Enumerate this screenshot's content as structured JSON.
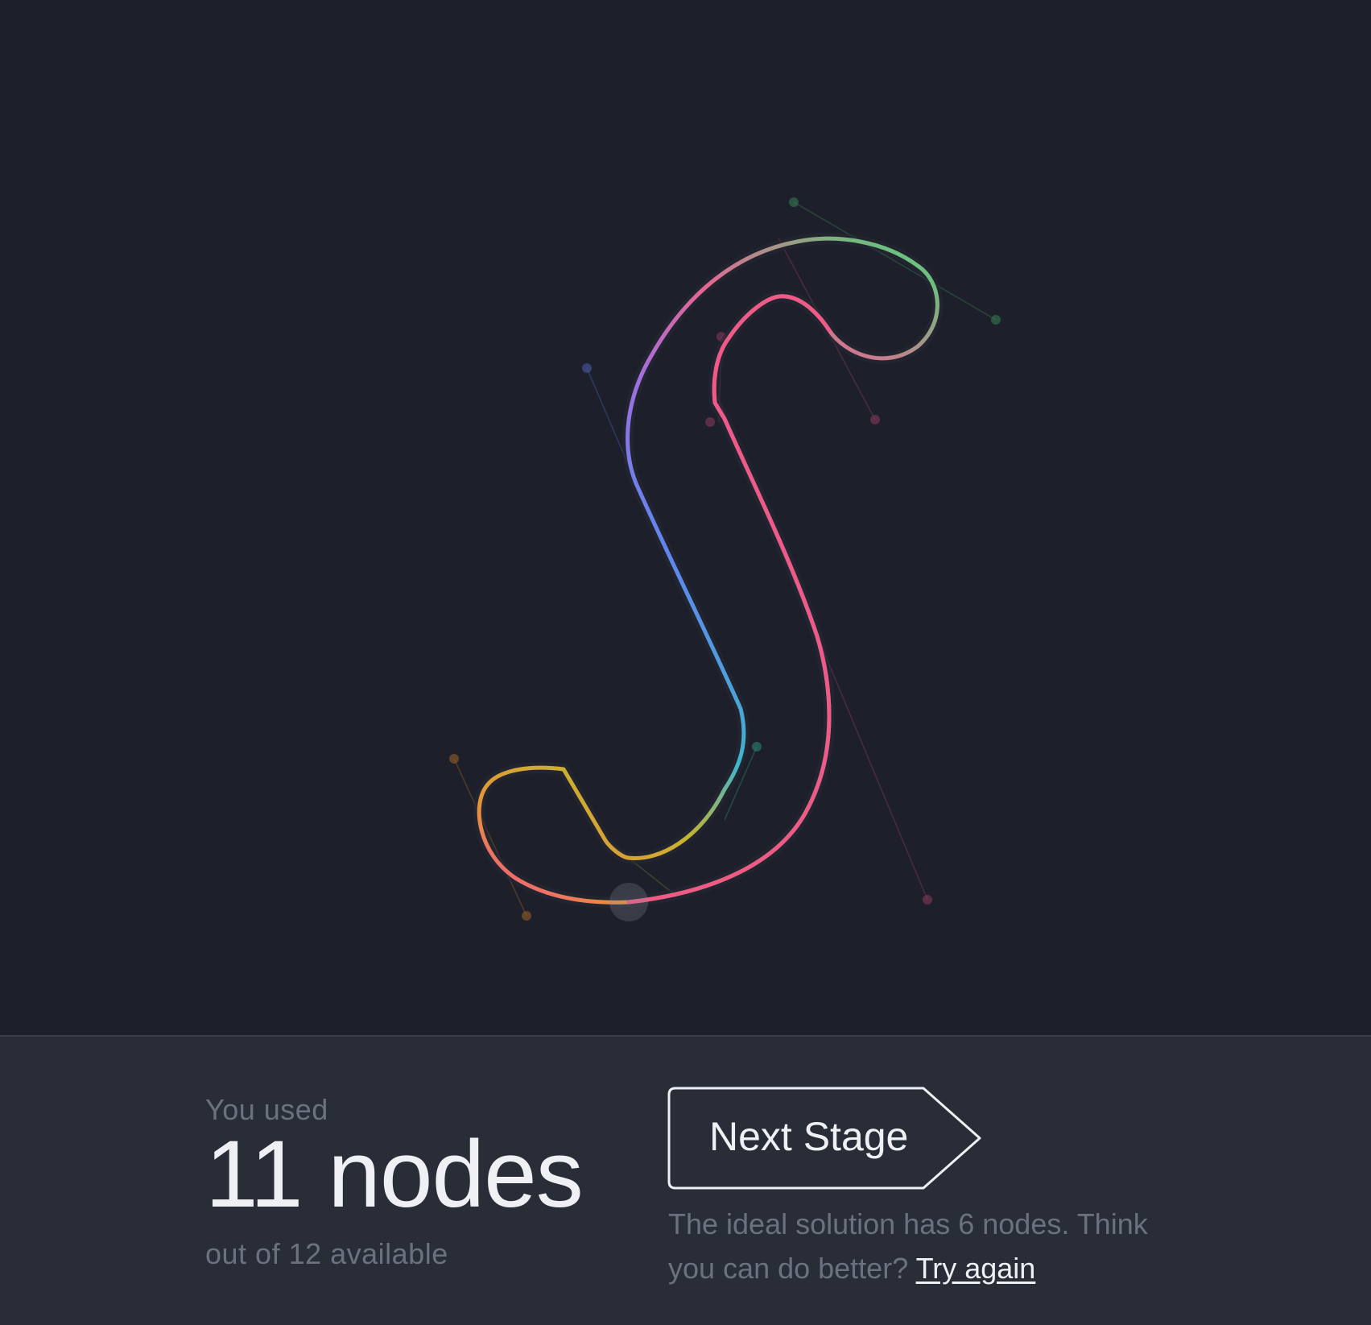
{
  "stage": {
    "glyph_letter": "S",
    "path_color": "#ef5a86",
    "gradient_stops": [
      "#6bc17f",
      "#e86592",
      "#a26ee0",
      "#5f86ef",
      "#3fb5cc",
      "#c6b42d",
      "#e8923a",
      "#ef5a86"
    ],
    "control_handle_opacity": 0.35
  },
  "result": {
    "caption": "You used",
    "count_label": "11 nodes",
    "available_label": "out of 12 available"
  },
  "next": {
    "label": "Next Stage"
  },
  "hint": {
    "text": "The ideal solution has 6 nodes. Think you can do better?",
    "link_label": "Try again"
  },
  "colors": {
    "background": "#1d202a",
    "panel": "#292d38",
    "text_primary": "#eef0f4",
    "text_muted": "#6c7180"
  }
}
